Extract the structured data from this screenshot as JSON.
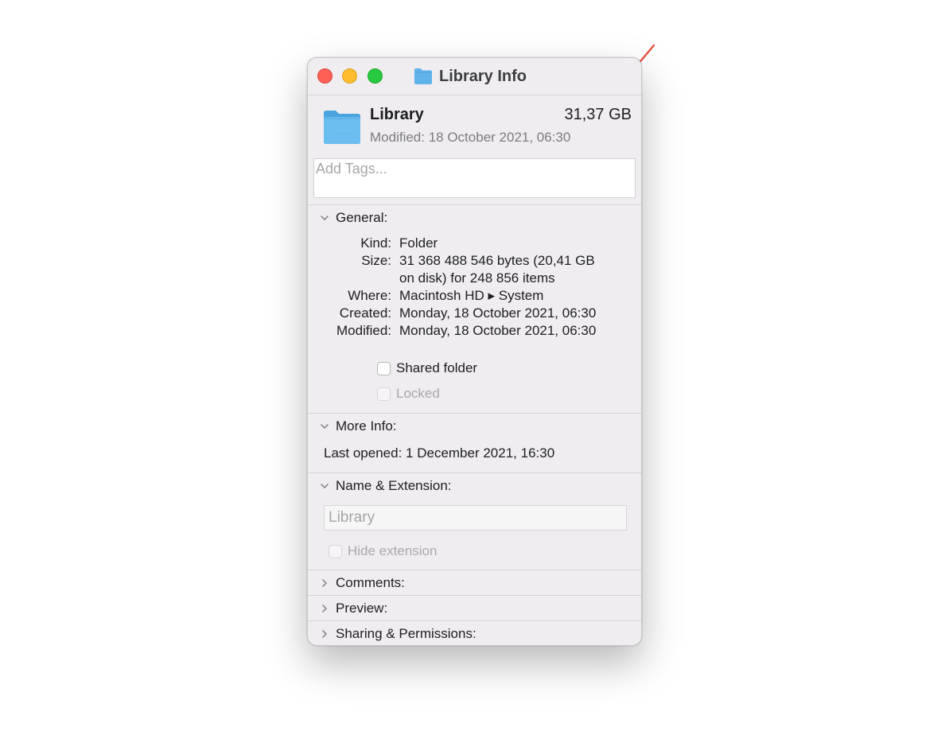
{
  "window": {
    "title": "Library Info",
    "title_icon": "folder-icon"
  },
  "header": {
    "name": "Library",
    "size": "31,37 GB",
    "modified": "Modified: 18 October 2021, 06:30",
    "icon": "folder-icon"
  },
  "tags": {
    "placeholder": "Add Tags..."
  },
  "general": {
    "label": "General:",
    "rows": [
      {
        "key": "Kind:",
        "value": "Folder"
      },
      {
        "key": "Size:",
        "value": "31 368 488 546 bytes (20,41 GB"
      },
      {
        "key": "",
        "value": "on disk) for 248 856 items"
      },
      {
        "key": "Where:",
        "value": "Macintosh HD ▸ System"
      },
      {
        "key": "Created:",
        "value": "Monday, 18 October 2021, 06:30"
      },
      {
        "key": "Modified:",
        "value": "Monday, 18 October 2021, 06:30"
      }
    ],
    "shared_folder": {
      "label": "Shared folder",
      "checked": false
    },
    "locked": {
      "label": "Locked",
      "checked": false,
      "disabled": true
    }
  },
  "more_info": {
    "label": "More Info:",
    "last_opened": "Last opened: 1 December 2021, 16:30"
  },
  "name_extension": {
    "label": "Name & Extension:",
    "value": "Library",
    "hide_extension": {
      "label": "Hide extension",
      "checked": false,
      "disabled": true
    }
  },
  "collapsed_sections": [
    {
      "label": "Comments:"
    },
    {
      "label": "Preview:"
    },
    {
      "label": "Sharing & Permissions:"
    }
  ],
  "colors": {
    "accent_folder": "#5fb3ea",
    "annotation_arrow": "#e8533f",
    "close": "#fe5f57",
    "minimize": "#febc2e",
    "zoom": "#28c840"
  }
}
